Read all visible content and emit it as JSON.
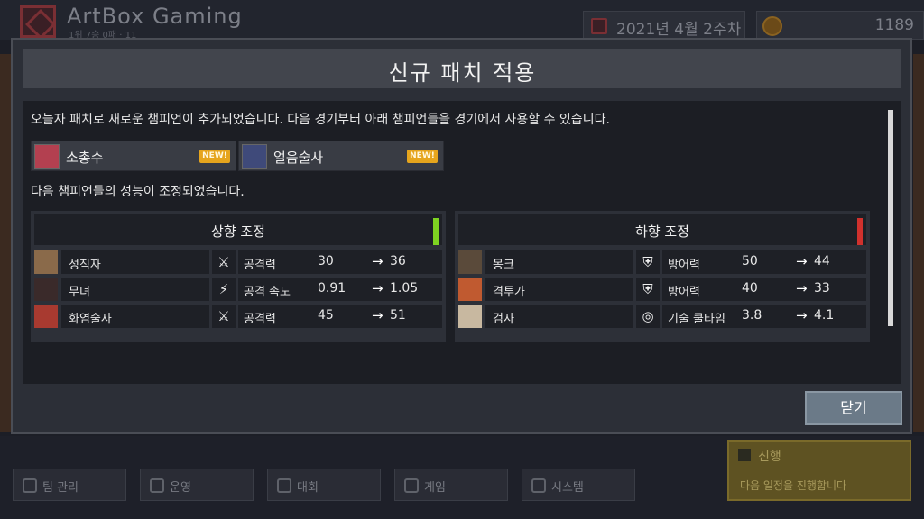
{
  "background": {
    "studio_name": "ArtBox Gaming",
    "studio_sub": "1위 7승 0패 · 11",
    "date": "2021년 4월 2주차",
    "gold": "1189",
    "nav": [
      {
        "label": "팀 관리",
        "icon": "shield-icon"
      },
      {
        "label": "운영",
        "icon": "document-icon"
      },
      {
        "label": "대회",
        "icon": "trophy-icon"
      },
      {
        "label": "게임",
        "icon": "gamepad-icon"
      },
      {
        "label": "시스템",
        "icon": "gear-icon"
      }
    ],
    "progress": {
      "title": "진행",
      "desc": "다음 일정을 진행합니다"
    }
  },
  "modal": {
    "title": "신규 패치 적용",
    "intro": "오늘자 패치로 새로운 챔피언이 추가되었습니다. 다음 경기부터 아래 챔피언들을 경기에서 사용할 수 있습니다.",
    "new_champions": [
      {
        "name": "소총수",
        "badge": "NEW!"
      },
      {
        "name": "얼음술사",
        "badge": "NEW!"
      }
    ],
    "adjust_note": "다음 챔피언들의 성능이 조정되었습니다.",
    "buff": {
      "title": "상향 조정",
      "color": "#7ed321",
      "rows": [
        {
          "name": "성직자",
          "icon": "sword-icon",
          "glyph": "⚔",
          "stat": "공격력",
          "old": "30",
          "arrow": "→",
          "new": "36"
        },
        {
          "name": "무녀",
          "icon": "attack-speed-icon",
          "glyph": "⚡",
          "stat": "공격 속도",
          "old": "0.91",
          "arrow": "→",
          "new": "1.05"
        },
        {
          "name": "화염술사",
          "icon": "sword-icon",
          "glyph": "⚔",
          "stat": "공격력",
          "old": "45",
          "arrow": "→",
          "new": "51"
        }
      ]
    },
    "nerf": {
      "title": "하향 조정",
      "color": "#d0312d",
      "rows": [
        {
          "name": "몽크",
          "icon": "armor-icon",
          "glyph": "⛨",
          "stat": "방어력",
          "old": "50",
          "arrow": "→",
          "new": "44"
        },
        {
          "name": "격투가",
          "icon": "armor-icon",
          "glyph": "⛨",
          "stat": "방어력",
          "old": "40",
          "arrow": "→",
          "new": "33"
        },
        {
          "name": "검사",
          "icon": "cooldown-icon",
          "glyph": "◎",
          "stat": "기술 쿨타임",
          "old": "3.8",
          "arrow": "→",
          "new": "4.1"
        }
      ]
    },
    "close_label": "닫기"
  }
}
